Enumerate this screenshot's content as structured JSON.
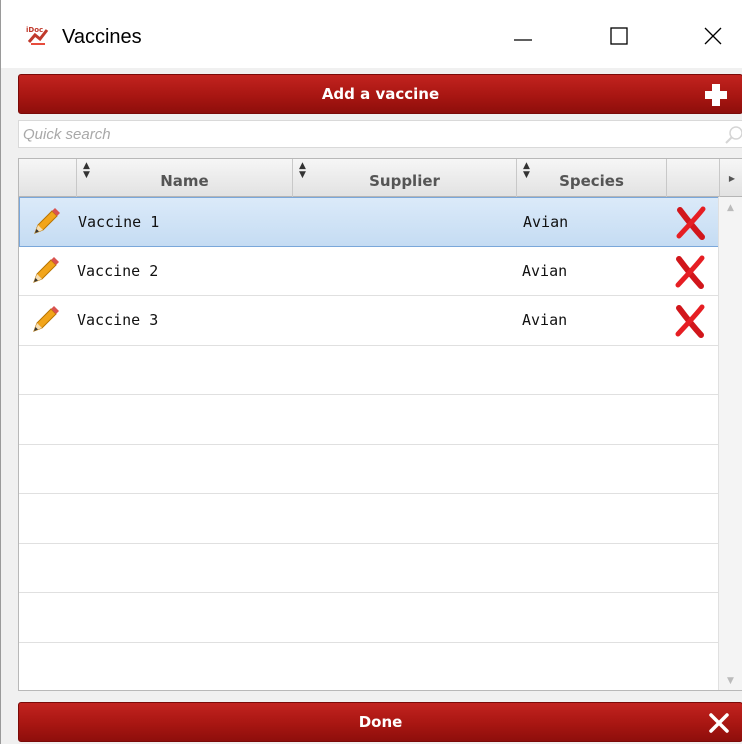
{
  "window": {
    "title": "Vaccines",
    "app_icon": "idoc-app-icon"
  },
  "toolbar": {
    "add_label": "Add a vaccine",
    "add_icon": "plus-icon"
  },
  "search": {
    "placeholder": "Quick search",
    "icon": "search-icon"
  },
  "table": {
    "columns": [
      "Name",
      "Supplier",
      "Species"
    ],
    "rows": [
      {
        "name": "Vaccine 1",
        "supplier": "",
        "species": "Avian",
        "selected": true
      },
      {
        "name": "Vaccine 2",
        "supplier": "",
        "species": "Avian",
        "selected": false
      },
      {
        "name": "Vaccine 3",
        "supplier": "",
        "species": "Avian",
        "selected": false
      }
    ],
    "row_icons": {
      "edit": "pencil-icon",
      "delete": "red-x-delete-icon"
    }
  },
  "footer": {
    "done_label": "Done",
    "done_icon": "close-icon"
  },
  "colors": {
    "bar_red": "#a81612",
    "selected_row": "#c5dcf3"
  }
}
